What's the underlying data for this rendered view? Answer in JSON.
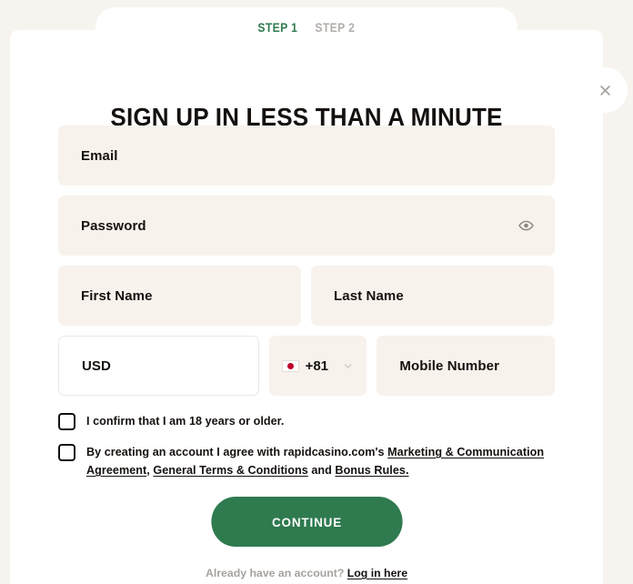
{
  "steps": {
    "active_index": 0,
    "items": [
      {
        "label": "STEP 1",
        "state": "active"
      },
      {
        "label": "STEP 2",
        "state": "inactive"
      }
    ]
  },
  "close_button": {
    "icon": "close-icon",
    "label": "✕"
  },
  "heading": "SIGN UP IN LESS THAN A MINUTE",
  "form": {
    "email": {
      "placeholder": "Email",
      "value": ""
    },
    "password": {
      "placeholder": "Password",
      "value": "",
      "toggle_icon": "eye-icon"
    },
    "first_name": {
      "placeholder": "First Name",
      "value": ""
    },
    "last_name": {
      "placeholder": "Last Name",
      "value": ""
    },
    "currency": {
      "selected": "USD",
      "options": [
        "USD"
      ]
    },
    "phone_code": {
      "selected": "+81",
      "flag": "japan-flag-icon",
      "chevron": "chevron-down-icon"
    },
    "mobile_number": {
      "placeholder": "Mobile Number",
      "value": ""
    }
  },
  "consents": [
    {
      "id": "age-confirm",
      "checked": false,
      "text": "I confirm that I am 18 years or older."
    },
    {
      "id": "terms-confirm",
      "checked": false,
      "prefix": "By creating an account I agree with rapidcasino.com's ",
      "link1": "Marketing & Communication Agreement",
      "sep1": ", ",
      "link2": "General Terms & Conditions",
      "sep2": " and ",
      "link3": "Bonus Rules.",
      "full_text": "By creating an account I agree with rapidcasino.com's Marketing & Communication Agreement, General Terms & Conditions and Bonus Rules."
    }
  ],
  "submit": {
    "label": "CONTINUE"
  },
  "footer": {
    "prompt": "Already have an account? ",
    "link": "Log in here"
  },
  "colors": {
    "page_background": "#f7f4ef",
    "modal_background": "#ffffff",
    "field_background": "#f7f2ec",
    "accent_green": "#2f7a4f",
    "text_primary": "#15110f",
    "text_muted": "#b2aeab",
    "flag_red": "#bc002d"
  }
}
